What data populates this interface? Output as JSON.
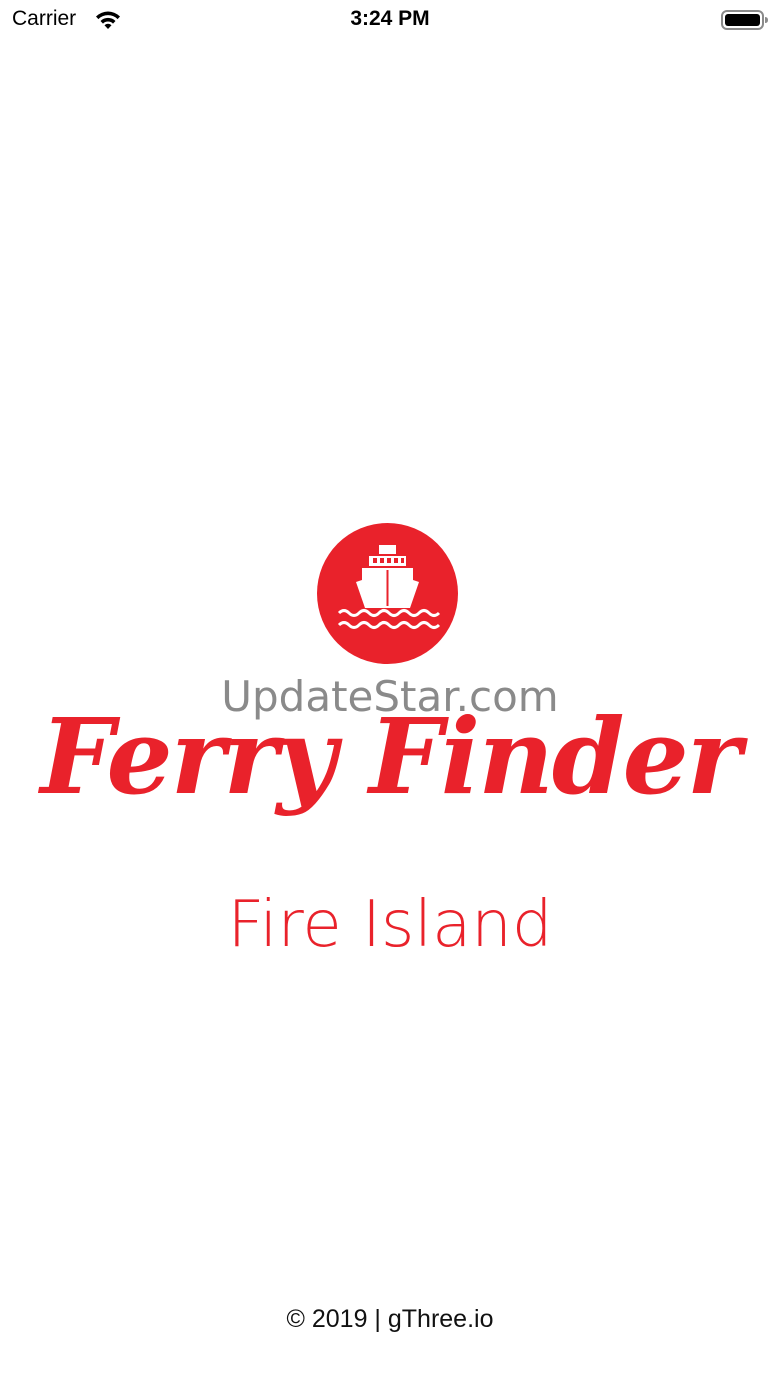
{
  "status_bar": {
    "carrier": "Carrier",
    "time": "3:24 PM",
    "wifi_icon": "wifi-icon",
    "battery_icon": "battery-icon"
  },
  "splash": {
    "logo_icon": "ferry-icon",
    "watermark": "UpdateStar.com",
    "app_title": "Ferry Finder",
    "subtitle": "Fire Island",
    "copyright": "© 2019 | gThree.io"
  },
  "colors": {
    "brand_red": "#e9222b",
    "background": "#ffffff"
  }
}
